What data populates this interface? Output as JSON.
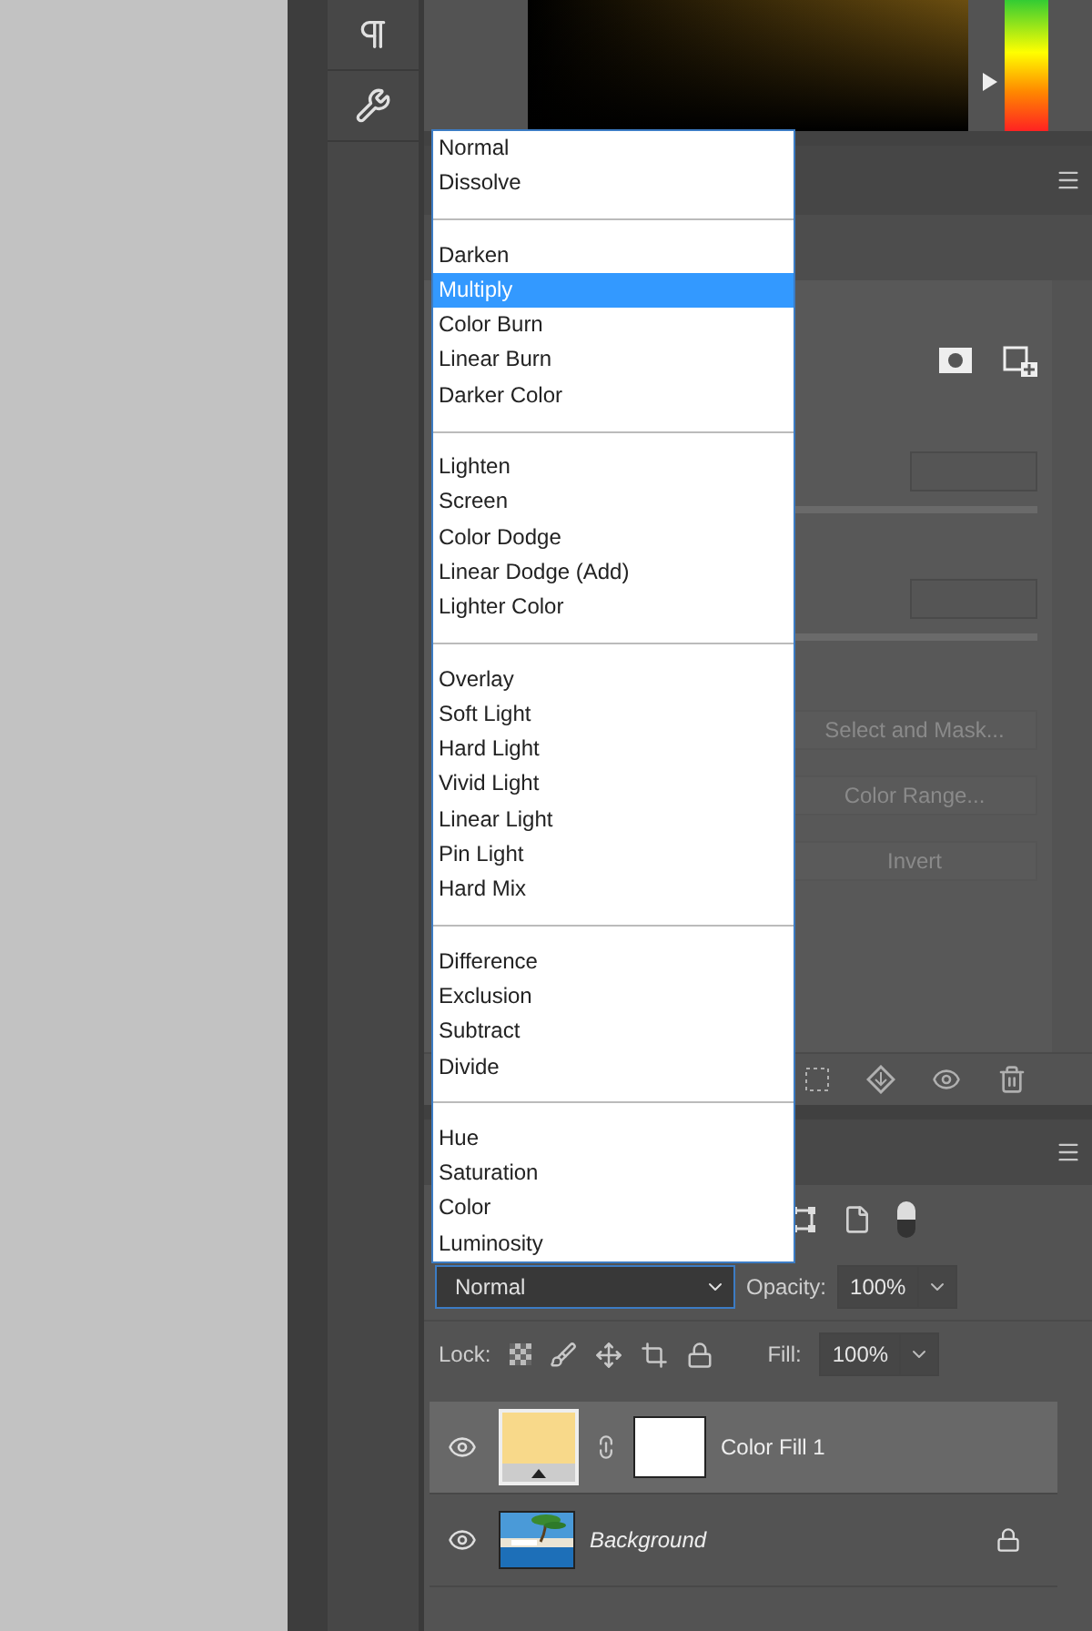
{
  "hue_slider": {
    "level": 0.38
  },
  "properties_panel": {
    "buttons": [
      "Select and Mask...",
      "Color Range...",
      "Invert"
    ]
  },
  "blend_menu": {
    "groups": [
      {
        "items": [
          {
            "label": "Normal",
            "selected": false
          },
          {
            "label": "Dissolve",
            "selected": false
          }
        ]
      },
      {
        "items": [
          {
            "label": "Darken",
            "selected": false
          },
          {
            "label": "Multiply",
            "selected": true
          },
          {
            "label": "Color Burn",
            "selected": false
          },
          {
            "label": "Linear Burn",
            "selected": false
          },
          {
            "label": "Darker Color",
            "selected": false
          }
        ]
      },
      {
        "items": [
          {
            "label": "Lighten",
            "selected": false
          },
          {
            "label": "Screen",
            "selected": false
          },
          {
            "label": "Color Dodge",
            "selected": false
          },
          {
            "label": "Linear Dodge (Add)",
            "selected": false
          },
          {
            "label": "Lighter Color",
            "selected": false
          }
        ]
      },
      {
        "items": [
          {
            "label": "Overlay",
            "selected": false
          },
          {
            "label": "Soft Light",
            "selected": false
          },
          {
            "label": "Hard Light",
            "selected": false
          },
          {
            "label": "Vivid Light",
            "selected": false
          },
          {
            "label": "Linear Light",
            "selected": false
          },
          {
            "label": "Pin Light",
            "selected": false
          },
          {
            "label": "Hard Mix",
            "selected": false
          }
        ]
      },
      {
        "items": [
          {
            "label": "Difference",
            "selected": false
          },
          {
            "label": "Exclusion",
            "selected": false
          },
          {
            "label": "Subtract",
            "selected": false
          },
          {
            "label": "Divide",
            "selected": false
          }
        ]
      },
      {
        "items": [
          {
            "label": "Hue",
            "selected": false
          },
          {
            "label": "Saturation",
            "selected": false
          },
          {
            "label": "Color",
            "selected": false
          },
          {
            "label": "Luminosity",
            "selected": false
          }
        ]
      }
    ]
  },
  "layers_panel": {
    "blend_mode": "Normal",
    "opacity_label": "Opacity:",
    "opacity": "100%",
    "lock_label": "Lock:",
    "fill_label": "Fill:",
    "fill": "100%",
    "layers": [
      {
        "name": "Color Fill 1",
        "kind": "fill",
        "selected": true,
        "locked": false
      },
      {
        "name": "Background",
        "selected": false,
        "locked": true
      }
    ]
  }
}
